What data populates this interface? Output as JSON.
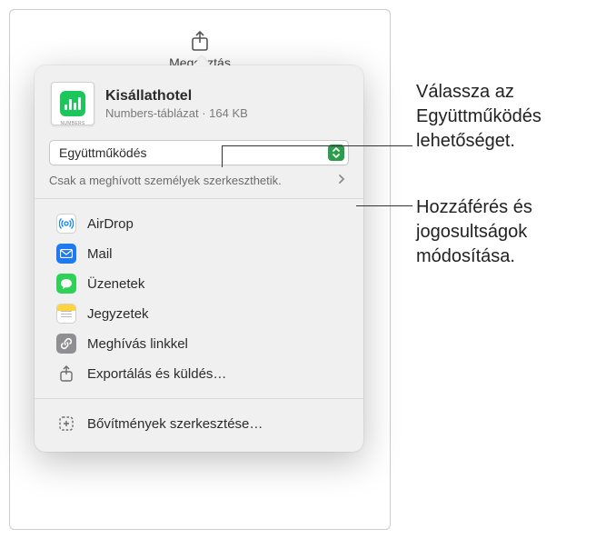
{
  "toolbar": {
    "share_label": "Megosztás"
  },
  "file": {
    "title": "Kisállathotel",
    "meta": "Numbers-táblázat · 164 KB",
    "thumb_badge": "NUMBERS"
  },
  "collab": {
    "mode_label": "Együttműködés",
    "permission_text": "Csak a meghívott személyek szerkeszthetik."
  },
  "actions": {
    "airdrop": "AirDrop",
    "mail": "Mail",
    "messages": "Üzenetek",
    "notes": "Jegyzetek",
    "invite_link": "Meghívás linkkel",
    "export_send": "Exportálás és küldés…",
    "edit_extensions": "Bővítmények szerkesztése…"
  },
  "annotations": {
    "a1": "Válassza az Együttműködés lehetőséget.",
    "a2": "Hozzáférés és jogosultságok módosítása."
  }
}
